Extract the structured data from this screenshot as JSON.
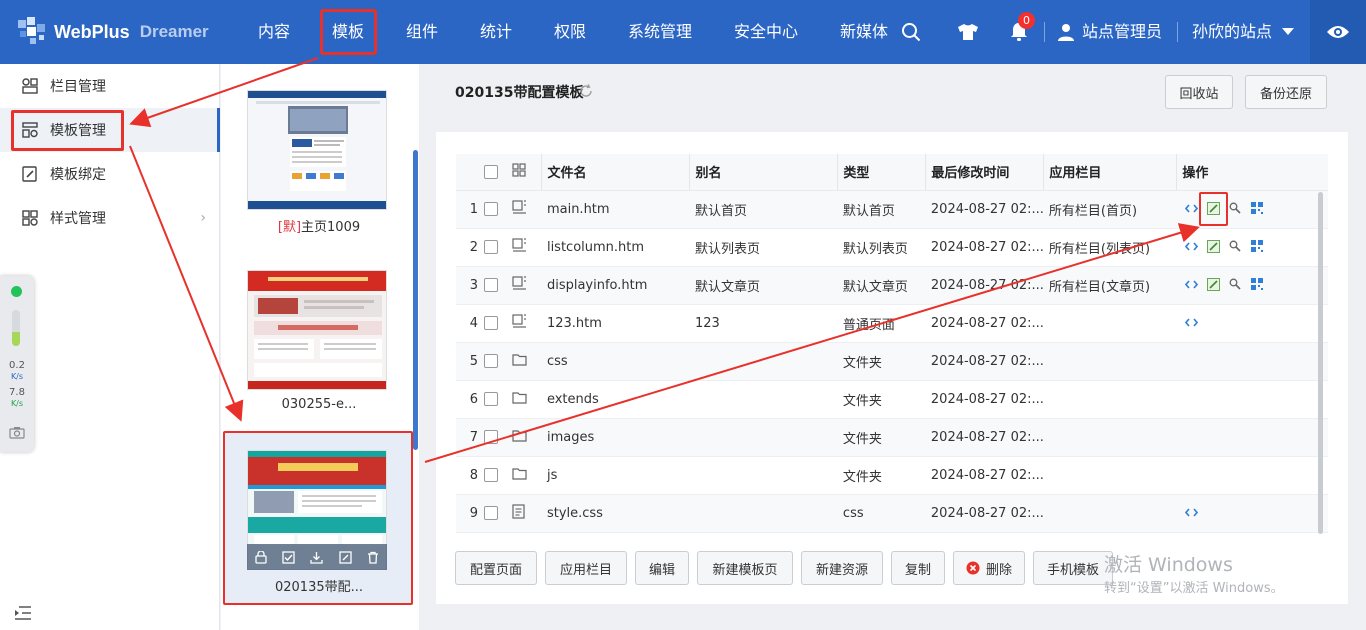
{
  "topbar": {
    "logo_text": "WebPlus",
    "logo_sub": "Dreamer",
    "nav": [
      "内容",
      "模板",
      "组件",
      "统计",
      "权限",
      "系统管理",
      "安全中心",
      "新媒体"
    ],
    "notifications_count": "0",
    "user_label": "站点管理员",
    "site_label": "孙欣的站点"
  },
  "sidebar": {
    "items": [
      {
        "label": "栏目管理",
        "icon": "column-icon"
      },
      {
        "label": "模板管理",
        "icon": "template-icon"
      },
      {
        "label": "模板绑定",
        "icon": "bind-icon"
      },
      {
        "label": "样式管理",
        "icon": "style-icon"
      }
    ]
  },
  "widget": {
    "upload_value": "0.2",
    "upload_unit": "K/s",
    "download_value": "7.8",
    "download_unit": "K/s"
  },
  "thumbnails": [
    {
      "default_mark": "[默]",
      "label": "主页1009"
    },
    {
      "default_mark": "",
      "label": "030255-e..."
    },
    {
      "default_mark": "",
      "label": "020135带配..."
    }
  ],
  "main": {
    "title": "020135带配置模板",
    "recycle_label": "回收站",
    "backup_label": "备份还原"
  },
  "table": {
    "headers": [
      "文件名",
      "别名",
      "类型",
      "最后修改时间",
      "应用栏目",
      "操作"
    ],
    "rows": [
      {
        "num": "1",
        "kind": "page",
        "name": "main.htm",
        "alias": "默认首页",
        "type": "默认首页",
        "time": "2024-08-27 02:...",
        "column": "所有栏目(首页)",
        "ops": 4
      },
      {
        "num": "2",
        "kind": "page",
        "name": "listcolumn.htm",
        "alias": "默认列表页",
        "type": "默认列表页",
        "time": "2024-08-27 02:...",
        "column": "所有栏目(列表页)",
        "ops": 4
      },
      {
        "num": "3",
        "kind": "page",
        "name": "displayinfo.htm",
        "alias": "默认文章页",
        "type": "默认文章页",
        "time": "2024-08-27 02:...",
        "column": "所有栏目(文章页)",
        "ops": 4
      },
      {
        "num": "4",
        "kind": "page",
        "name": "123.htm",
        "alias": "123",
        "type": "普通页面",
        "time": "2024-08-27 02:...",
        "column": "",
        "ops": 1
      },
      {
        "num": "5",
        "kind": "folder",
        "name": "css",
        "alias": "",
        "type": "文件夹",
        "time": "2024-08-27 02:...",
        "column": "",
        "ops": 0
      },
      {
        "num": "6",
        "kind": "folder",
        "name": "extends",
        "alias": "",
        "type": "文件夹",
        "time": "2024-08-27 02:...",
        "column": "",
        "ops": 0
      },
      {
        "num": "7",
        "kind": "folder",
        "name": "images",
        "alias": "",
        "type": "文件夹",
        "time": "2024-08-27 02:...",
        "column": "",
        "ops": 0
      },
      {
        "num": "8",
        "kind": "folder",
        "name": "js",
        "alias": "",
        "type": "文件夹",
        "time": "2024-08-27 02:...",
        "column": "",
        "ops": 0
      },
      {
        "num": "9",
        "kind": "file",
        "name": "style.css",
        "alias": "",
        "type": "css",
        "time": "2024-08-27 02:...",
        "column": "",
        "ops": 1
      }
    ]
  },
  "bottom_buttons": [
    "配置页面",
    "应用栏目",
    "编辑",
    "新建模板页",
    "新建资源",
    "复制",
    "删除",
    "手机模板"
  ],
  "watermark": {
    "line1": "激活 Windows",
    "line2": "转到“设置”以激活 Windows。"
  },
  "colors": {
    "topbar": "#2b66c4",
    "annotation": "#e8312a",
    "link": "#3a7bd5"
  }
}
